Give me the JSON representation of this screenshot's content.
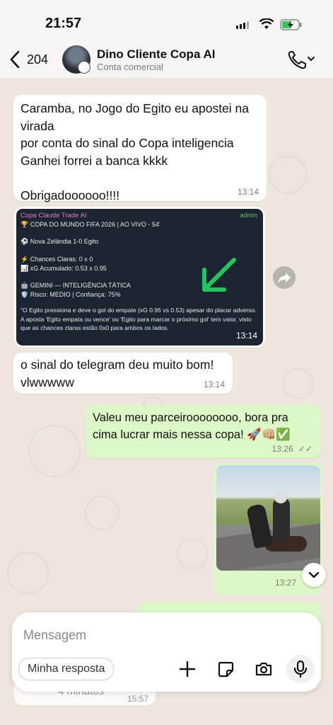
{
  "status_bar": {
    "time": "21:57"
  },
  "header": {
    "back_count": "204",
    "contact_name": "Dino Cliente Copa AI",
    "contact_subtitle": "Conta comercial"
  },
  "messages": [
    {
      "id": "m1",
      "direction": "incoming",
      "text": "Caramba, no Jogo do Egito eu apostei na\nvirada\npor conta do sinal do Copa inteligencia\nGanhei forrei a banca kkkk\n\nObrigadoooooo!!!!",
      "time": "13:14"
    },
    {
      "id": "m2",
      "direction": "incoming",
      "type": "image",
      "time": "13:14",
      "screenshot": {
        "sender": "Copa Claude Trade AI",
        "badge": "admin",
        "lines": [
          "🏆 COPA DO MUNDO FIFA 2026 | AO VIVO - 54'",
          "⚽ Nova Zelândia 1-0 Egito",
          "⚡ Chances Claras: 0 x 0",
          "📊 xG Acumulado: 0.53 x 0.95",
          "🤖 GEMINI — INTELIGÊNCIA TÁTICA",
          "🛡️ Risco: MEDIO | Confiança: 75%"
        ],
        "paragraph": "\"O Egito pressiona e deve o gol do empate (xG 0.95 vs 0.53) apesar do placar adverso. A aposta 'Egito empata ou vence' ou 'Egito para marcar o próximo gol' tem valor, visto que as chances claras estão 0x0 para ambos os lados.",
        "arrow_color": "#22c55e"
      }
    },
    {
      "id": "m3",
      "direction": "incoming",
      "text": "o sinal do telegram deu muito bom!\nvlwwwww",
      "time": "13:14"
    },
    {
      "id": "m4",
      "direction": "outgoing",
      "text": "Valeu meu parceiroooooooo, bora pra\ncima lucrar mais nessa copa! 🚀👊🏼✅",
      "time": "13:26"
    },
    {
      "id": "m5",
      "direction": "outgoing",
      "type": "image",
      "time": "13:27"
    }
  ],
  "partial_message": {
    "text": "4 minutos",
    "time": "15:57"
  },
  "composer": {
    "placeholder": "Mensagem",
    "chip_label": "Minha resposta"
  },
  "colors": {
    "incoming_bubble": "#ffffff",
    "outgoing_bubble": "#dcf8c6",
    "wallpaper": "#ece6dc"
  }
}
